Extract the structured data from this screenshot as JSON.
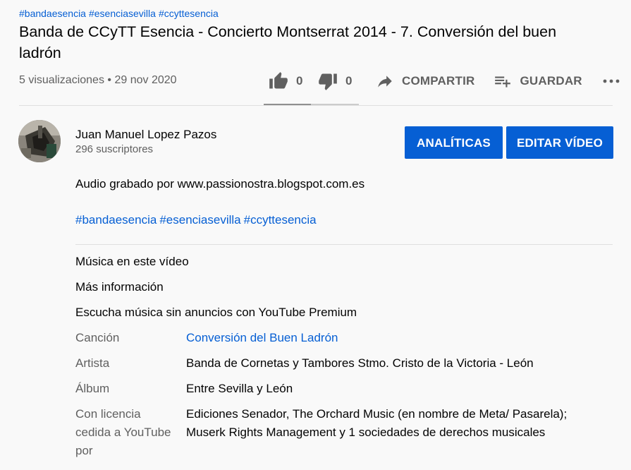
{
  "video": {
    "hashtags": [
      "#bandaesencia",
      "#esenciasevilla",
      "#ccyttesencia"
    ],
    "title": "Banda de CCyTT Esencia - Concierto Montserrat 2014 - 7. Conversión del buen ladrón",
    "views": "5 visualizaciones",
    "separator": "•",
    "date": "29 nov 2020"
  },
  "actions": {
    "like_count": "0",
    "dislike_count": "0",
    "share_label": "COMPARTIR",
    "save_label": "GUARDAR",
    "like_icon": "thumb-up-icon",
    "dislike_icon": "thumb-down-icon",
    "share_icon": "share-arrow-icon",
    "save_icon": "playlist-add-icon",
    "more_icon": "more-horizontal-icon"
  },
  "channel": {
    "name": "Juan Manuel Lopez Pazos",
    "subscribers": "296 suscriptores"
  },
  "buttons": {
    "analytics": "ANALÍTICAS",
    "edit": "EDITAR VÍDEO"
  },
  "description": {
    "text": "Audio grabado por www.passionostra.blogspot.com.es",
    "hashtags": [
      "#bandaesencia",
      "#esenciasevilla",
      "#ccyttesencia"
    ]
  },
  "music": {
    "heading": "Música en este vídeo",
    "more_info": "Más información",
    "premium": "Escucha música sin anuncios con YouTube Premium",
    "rows": [
      {
        "label": "Canción",
        "value": "Conversión del Buen Ladrón"
      },
      {
        "label": "Artista",
        "value": "Banda de Cornetas y Tambores Stmo. Cristo de la Victoria - León"
      },
      {
        "label": "Álbum",
        "value": "Entre Sevilla y León"
      },
      {
        "label": "Con licencia cedida a YouTube por",
        "value": "Ediciones Senador, The Orchard Music (en nombre de Meta/ Pasarela); Muserk Rights Management y 1 sociedades de derechos musicales"
      }
    ]
  },
  "colors": {
    "link": "#065fd4",
    "button_bg": "#065fd4",
    "text_primary": "#030303",
    "text_secondary": "#606060",
    "background": "#f9f9f9"
  }
}
